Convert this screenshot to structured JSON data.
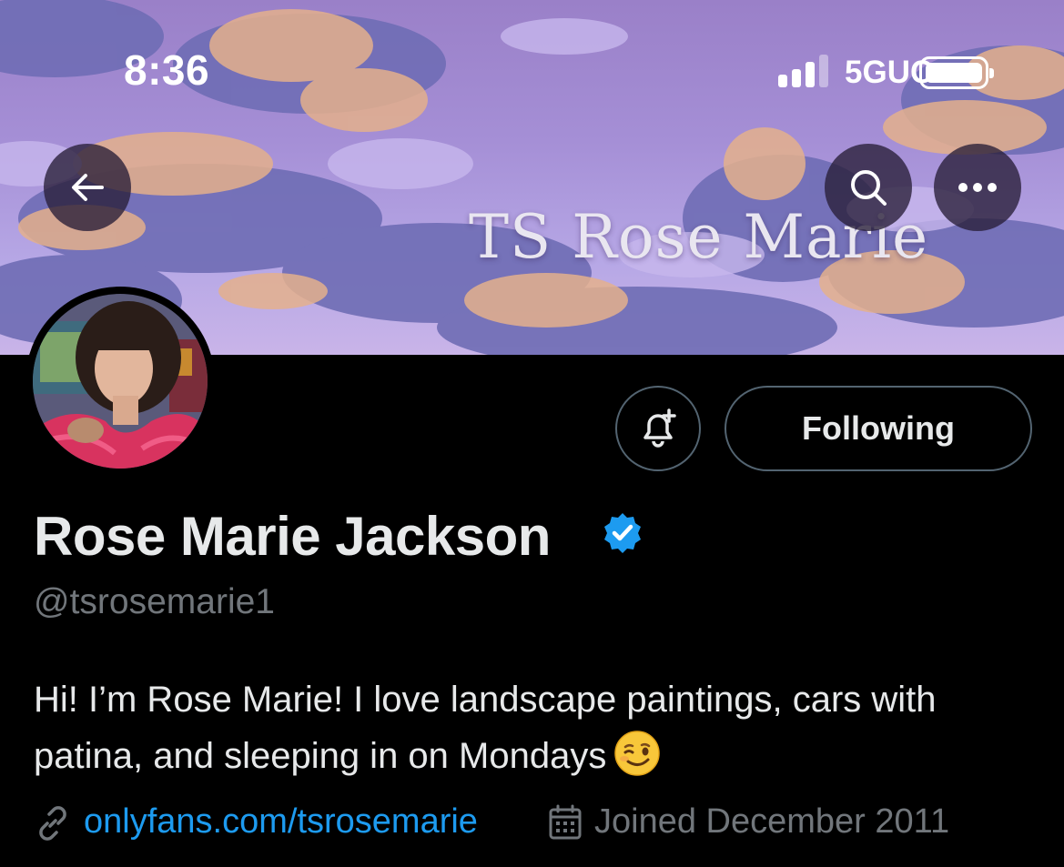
{
  "status_bar": {
    "time": "8:36",
    "network": "5GUC"
  },
  "banner": {
    "text": "TS Rose Marie",
    "sky_color": "#a58fd6"
  },
  "nav": {
    "back_icon": "arrow-left-icon",
    "search_icon": "search-icon",
    "more_icon": "ellipsis-icon"
  },
  "actions": {
    "notify_icon": "bell-plus-icon",
    "following_label": "Following"
  },
  "profile": {
    "display_name": "Rose Marie Jackson",
    "verified": true,
    "handle": "@tsrosemarie1",
    "bio": "Hi! I’m Rose Marie! I love landscape paintings, cars with patina, and sleeping in on Mondays",
    "bio_emoji": "winking-face",
    "link": "onlyfans.com/tsrosemarie",
    "joined": "Joined December 2011"
  },
  "colors": {
    "background": "#000000",
    "link": "#1d9bf0",
    "muted": "#71767b",
    "verified": "#1d9bf0"
  }
}
